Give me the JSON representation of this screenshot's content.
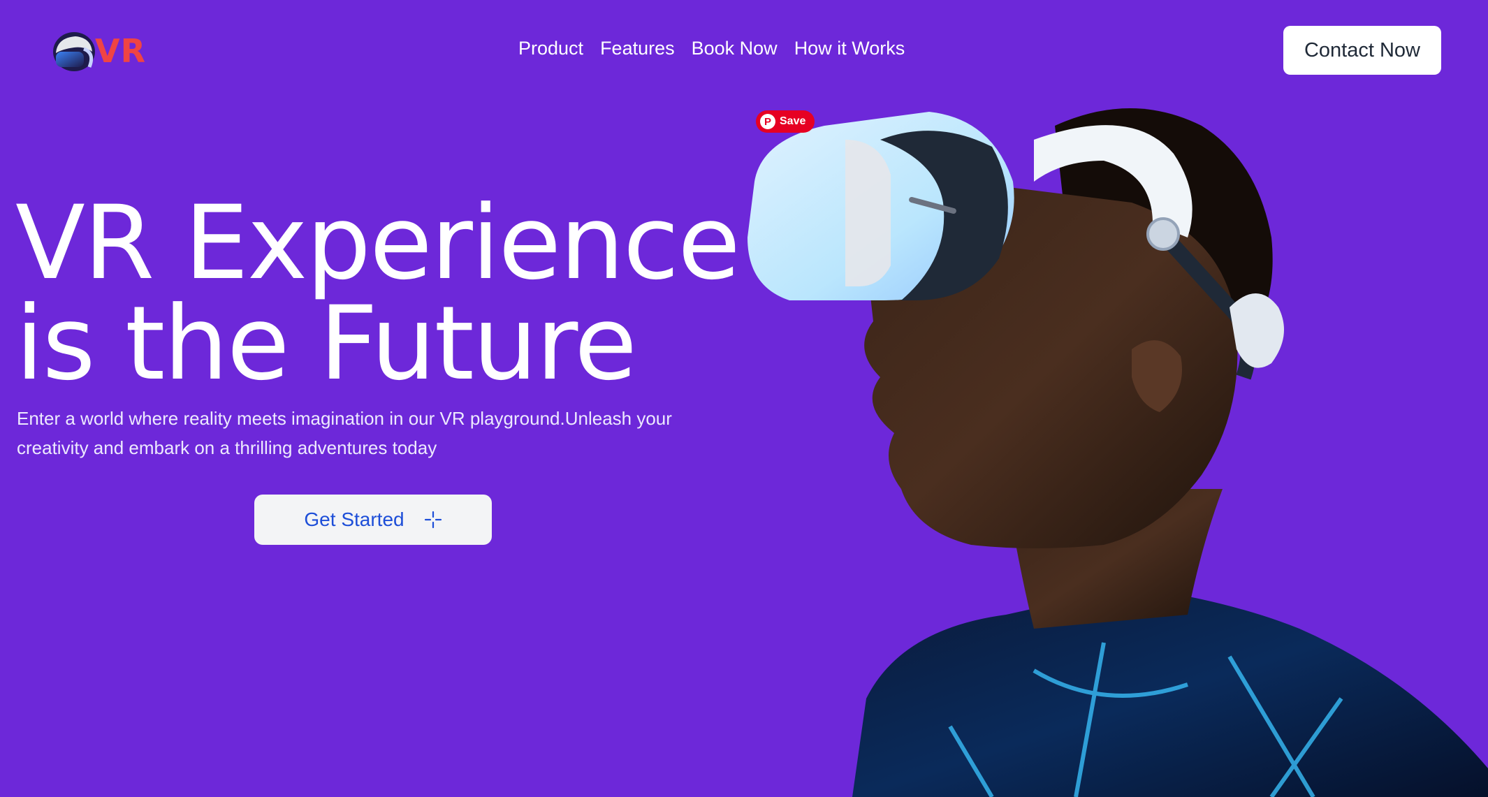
{
  "brand": {
    "logo_text": "VR",
    "logo_color": "#ef4444"
  },
  "nav": {
    "items": [
      {
        "label": "Product"
      },
      {
        "label": "Features"
      },
      {
        "label": "Book Now"
      },
      {
        "label": "How it Works"
      }
    ]
  },
  "header": {
    "contact_label": "Contact Now"
  },
  "hero": {
    "title_line1": "VR Experience",
    "title_line2": "is the Future",
    "description": "Enter a world where reality meets imagination in our VR playground.Unleash your creativity and embark on a thrilling adventures today",
    "cta_label": "Get Started",
    "cta_icon": "sparkle-cursor-icon"
  },
  "image": {
    "subject": "person-wearing-vr-headset",
    "pin_label": "Save"
  },
  "colors": {
    "background": "#6d28d9",
    "text": "#ffffff",
    "cta_text": "#1d4ed8",
    "pinterest": "#e60023"
  }
}
